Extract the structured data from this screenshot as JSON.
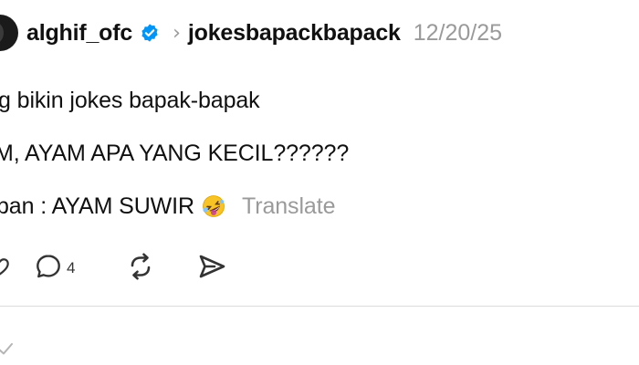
{
  "post": {
    "username": "alghif_ofc",
    "community": "jokesbapackbapack",
    "timestamp": "12/20/25",
    "lines": [
      "g bikin jokes bapak-bapak",
      "M, AYAM APA YANG KECIL??????",
      "ban : AYAM SUWIR"
    ],
    "emoji": "rofl-emoji",
    "translate_label": "Translate",
    "reply_count": "4"
  },
  "icons": {
    "verified": "verified-badge-icon",
    "chevron": "chevron-right-icon",
    "reply": "comment-bubble-icon",
    "repost": "repost-icon",
    "share": "send-icon",
    "like": "heart-icon",
    "check": "check-icon"
  },
  "colors": {
    "verified_blue": "#0095f6",
    "muted_text": "#9a9a9a"
  }
}
